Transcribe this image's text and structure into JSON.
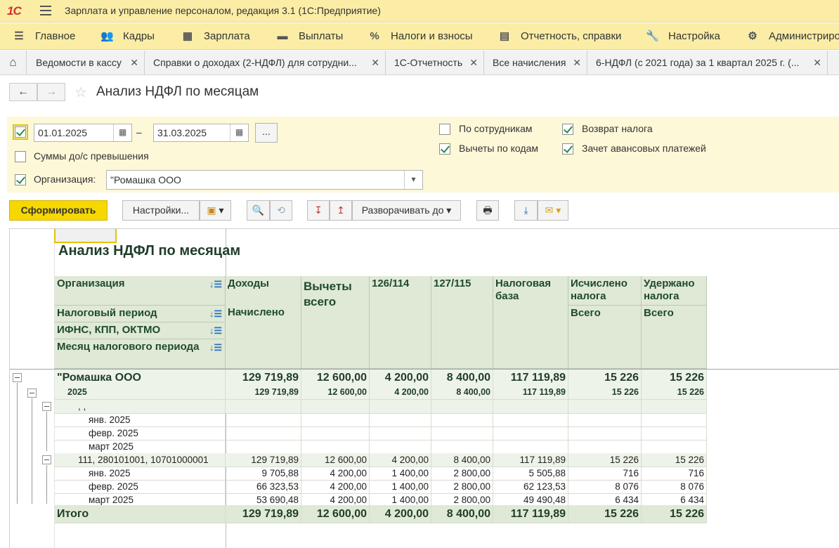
{
  "app": {
    "title": "Зарплата и управление персоналом, редакция 3.1  (1С:Предприятие)",
    "logo": "1С"
  },
  "sections": [
    "Главное",
    "Кадры",
    "Зарплата",
    "Выплаты",
    "Налоги и взносы",
    "Отчетность, справки",
    "Настройка",
    "Администриров"
  ],
  "tabs": [
    "Ведомости в кассу",
    "Справки о доходах (2-НДФЛ) для сотрудни...",
    "1С-Отчетность",
    "Все начисления",
    "6-НДФЛ (с 2021 года) за 1 квартал 2025 г. (..."
  ],
  "page": {
    "title": "Анализ НДФЛ по месяцам"
  },
  "filters": {
    "date_from": "01.01.2025",
    "date_to": "31.03.2025",
    "dash": "–",
    "dots": "...",
    "sums_label": "Суммы до/с превышения",
    "org_label": "Организация:",
    "org_value": "\"Ромашка ООО",
    "by_employees": "По сотрудникам",
    "deductions_by_codes": "Вычеты по кодам",
    "tax_refund": "Возврат налога",
    "advance_offset": "Зачет авансовых платежей"
  },
  "toolbar": {
    "generate": "Сформировать",
    "settings": "Настройки...",
    "expand_to": "Разворачивать до"
  },
  "report": {
    "title": "Анализ НДФЛ по месяцам",
    "header": {
      "org": "Организация",
      "period": "Налоговый период",
      "ifns": "ИФНС, КПП, ОКТМО",
      "month": "Месяц налогового периода",
      "income": "Доходы",
      "accrued": "Начислено",
      "deductions": "Вычеты всего",
      "c126": "126/114",
      "c127": "127/115",
      "base": "Налоговая база",
      "calc": "Исчислено налога",
      "calc_total": "Всего",
      "withheld": "Удержано налога",
      "withheld_total": "Всего"
    },
    "rows": [
      {
        "label": "\"Ромашка ООО",
        "v": [
          "129 719,89",
          "12 600,00",
          "4 200,00",
          "8 400,00",
          "117 119,89",
          "15 226",
          "15 226"
        ]
      },
      {
        "label": "2025",
        "v": [
          "129 719,89",
          "12 600,00",
          "4 200,00",
          "8 400,00",
          "117 119,89",
          "15 226",
          "15 226"
        ]
      },
      {
        "label": ", ,",
        "v": [
          "",
          "",
          "",
          "",
          "",
          "",
          ""
        ]
      },
      {
        "label": "янв. 2025",
        "v": [
          "",
          "",
          "",
          "",
          "",
          "",
          ""
        ]
      },
      {
        "label": "февр. 2025",
        "v": [
          "",
          "",
          "",
          "",
          "",
          "",
          ""
        ]
      },
      {
        "label": "март 2025",
        "v": [
          "",
          "",
          "",
          "",
          "",
          "",
          ""
        ]
      },
      {
        "label": "111, 280101001, 10701000001",
        "v": [
          "129 719,89",
          "12 600,00",
          "4 200,00",
          "8 400,00",
          "117 119,89",
          "15 226",
          "15 226"
        ]
      },
      {
        "label": "янв. 2025",
        "v": [
          "9 705,88",
          "4 200,00",
          "1 400,00",
          "2 800,00",
          "5 505,88",
          "716",
          "716"
        ]
      },
      {
        "label": "февр. 2025",
        "v": [
          "66 323,53",
          "4 200,00",
          "1 400,00",
          "2 800,00",
          "62 123,53",
          "8 076",
          "8 076"
        ]
      },
      {
        "label": "март 2025",
        "v": [
          "53 690,48",
          "4 200,00",
          "1 400,00",
          "2 800,00",
          "49 490,48",
          "6 434",
          "6 434"
        ]
      }
    ],
    "total": {
      "label": "Итого",
      "v": [
        "129 719,89",
        "12 600,00",
        "4 200,00",
        "8 400,00",
        "117 119,89",
        "15 226",
        "15 226"
      ]
    }
  }
}
